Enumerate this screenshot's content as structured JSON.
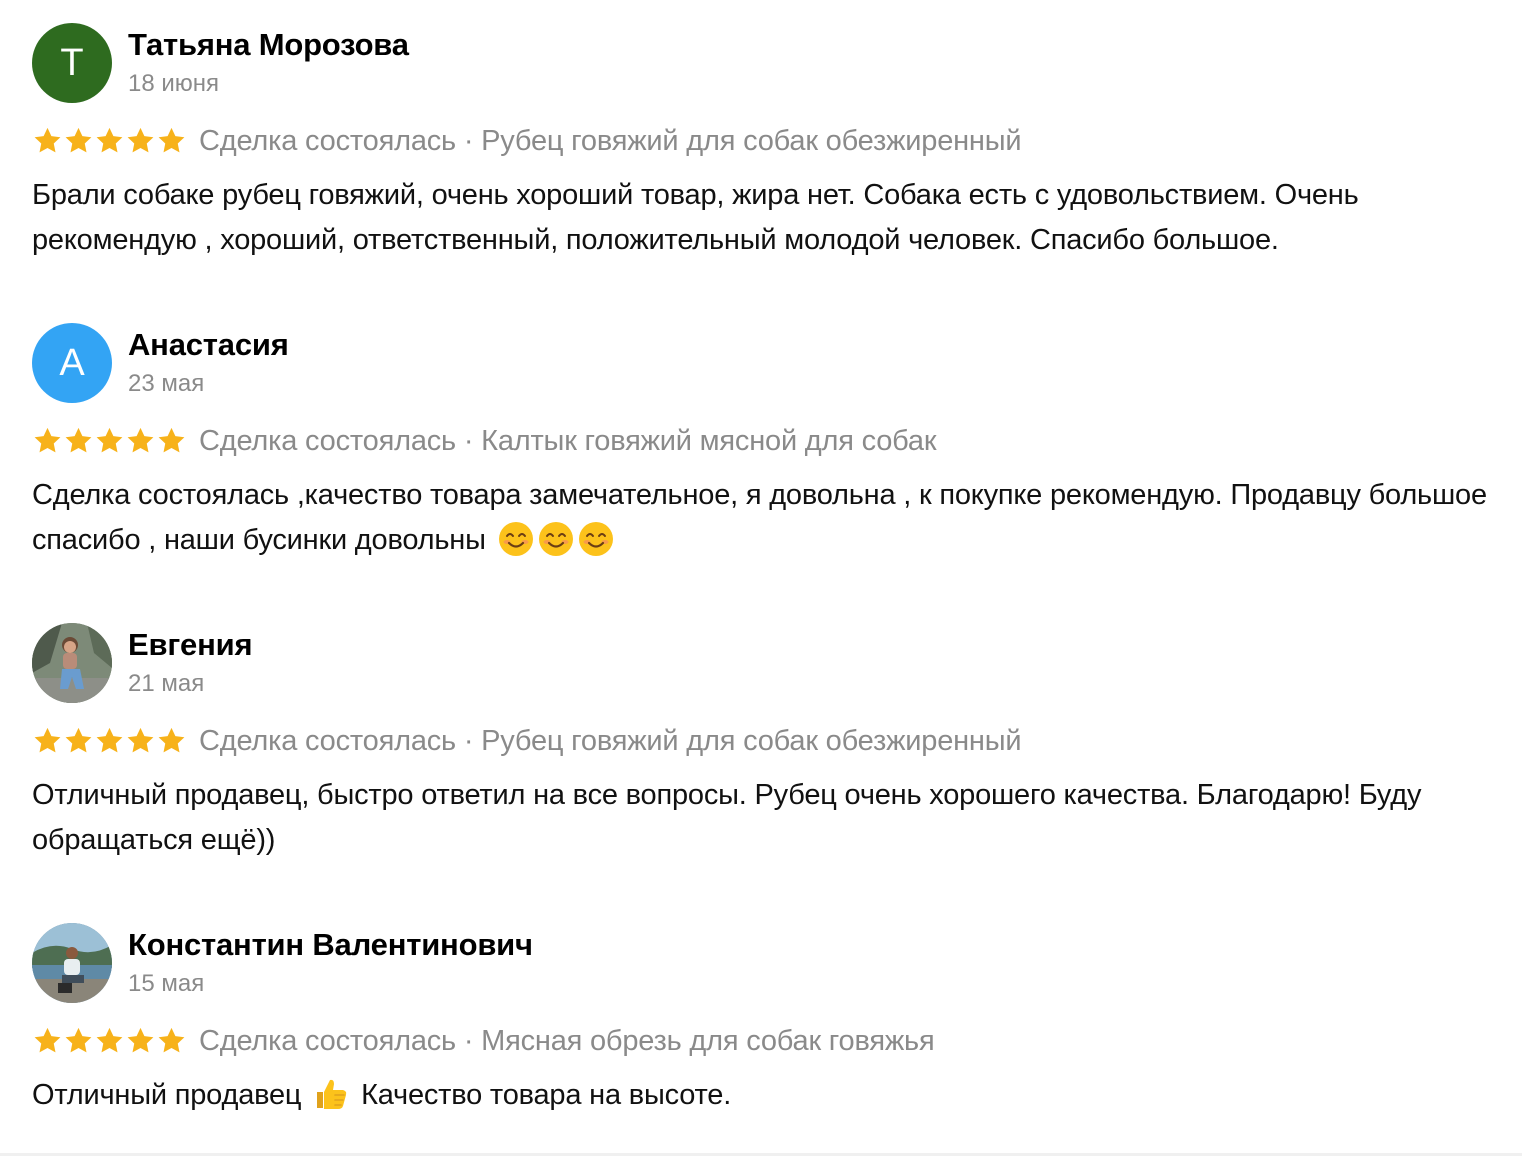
{
  "reviews": [
    {
      "avatar_letter": "Т",
      "avatar_color": "#2e6b1f",
      "author": "Татьяна Морозова",
      "date": "18 июня",
      "rating": 5,
      "meta": "Сделка состоялась · Рубец говяжий для собак обезжиренный",
      "text": "Брали собаке рубец говяжий, очень хороший товар, жира нет. Собака есть с удовольствием. Очень рекомендую , хороший, ответственный, положительный молодой человек. Спасибо большое."
    },
    {
      "avatar_letter": "А",
      "avatar_color": "#33a4f4",
      "author": "Анастасия",
      "date": "23 мая",
      "rating": 5,
      "meta": "Сделка состоялась · Калтык говяжий мясной для собак",
      "text": "Сделка состоялась ,качество товара замечательное, я довольна , к покупке рекомендую. Продавцу большое спасибо , наши бусинки довольны",
      "emoji": [
        "smiling-face-icon",
        "smiling-face-icon",
        "smiling-face-icon"
      ]
    },
    {
      "avatar_icon": "user-photo",
      "author": "Евгения",
      "date": "21 мая",
      "rating": 5,
      "meta": "Сделка состоялась · Рубец говяжий для собак обезжиренный",
      "text": "Отличный продавец, быстро ответил на все вопросы. Рубец очень хорошего качества. Благодарю! Буду обращаться ещё))"
    },
    {
      "avatar_icon": "user-photo",
      "author": "Константин Валентинович",
      "date": "15 мая",
      "rating": 5,
      "meta": "Сделка состоялась · Мясная обрезь для собак говяжья",
      "text_before": "Отличный продавец",
      "emoji": [
        "thumbs-up-icon"
      ],
      "text_after": "Качество товара на высоте."
    }
  ],
  "colors": {
    "star": "#f7b21a",
    "secondary_text": "#8a8a8a"
  }
}
